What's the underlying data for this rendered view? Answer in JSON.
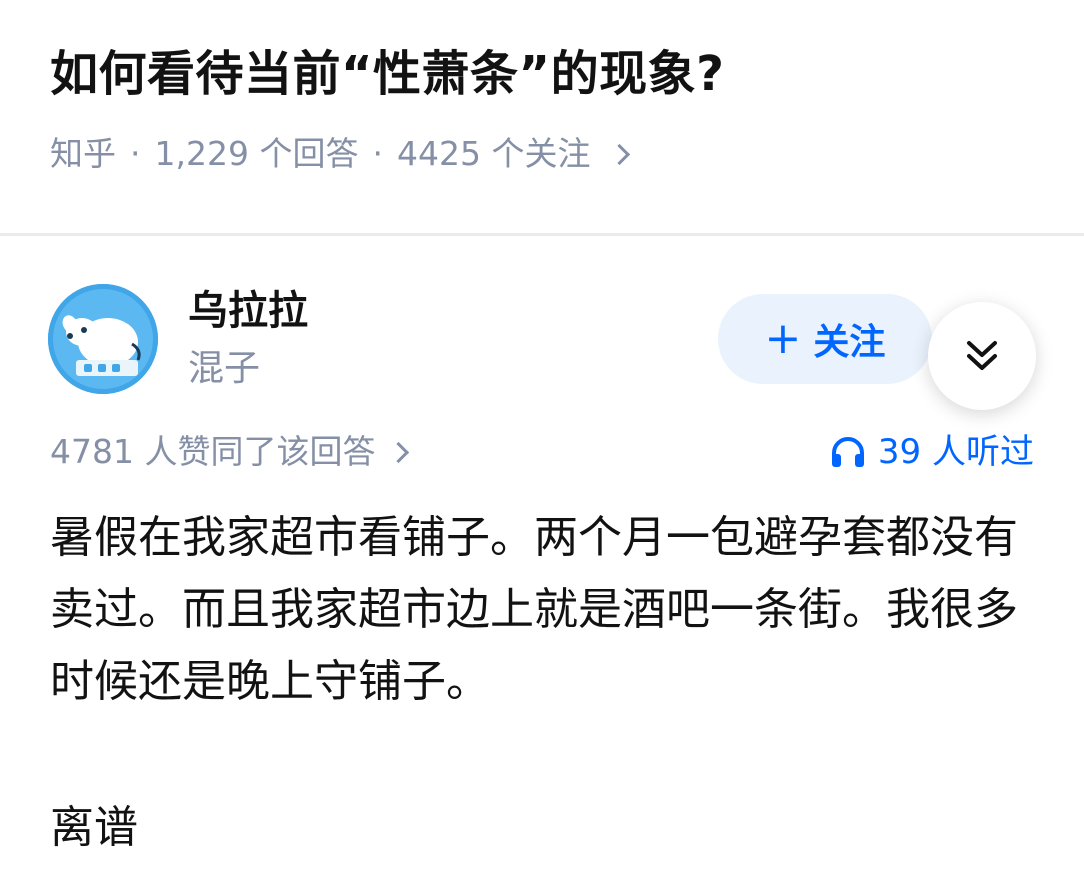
{
  "question": {
    "title": "如何看待当前“性萧条”的现象?",
    "source": "知乎",
    "answers": "1,229 个回答",
    "followers": "4425 个关注",
    "separator": "·"
  },
  "author": {
    "name": "乌拉拉",
    "headline": "混子",
    "follow_label": "关注"
  },
  "answer": {
    "votes_text": "4781 人赞同了该回答",
    "listen_text": "39 人听过",
    "paragraphs": [
      "暑假在我家超市看铺子。两个月一包避孕套都没有卖过。而且我家超市边上就是酒吧一条街。我很多时候还是晚上守铺子。",
      "离谱"
    ]
  },
  "colors": {
    "accent": "#0066ff",
    "meta": "#8590a6",
    "follow_bg": "#eaf2fd",
    "avatar_bg": "#3fa4e6"
  },
  "icons": [
    "chevron-right-icon",
    "plus-icon",
    "double-chevron-down-icon",
    "headphones-icon"
  ]
}
